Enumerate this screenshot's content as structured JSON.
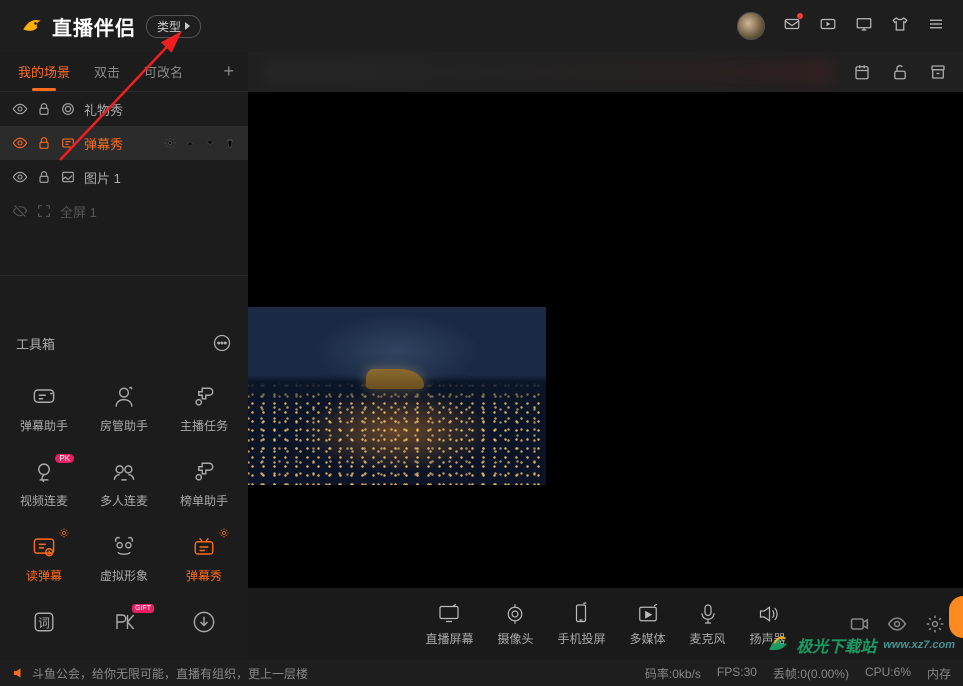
{
  "header": {
    "title": "直播伴侣",
    "type_label": "类型"
  },
  "sidebar": {
    "tabs": [
      {
        "label": "我的场景",
        "active": true
      },
      {
        "label": "双击",
        "active": false
      },
      {
        "label": "可改名",
        "active": false
      }
    ],
    "scenes": [
      {
        "name": "礼物秀",
        "active": false,
        "dim": false,
        "icon": "gift"
      },
      {
        "name": "弹幕秀",
        "active": true,
        "dim": false,
        "icon": "danmu"
      },
      {
        "name": "图片 1",
        "active": false,
        "dim": false,
        "icon": "image"
      },
      {
        "name": "全屏 1",
        "active": false,
        "dim": true,
        "icon": "fullscreen"
      }
    ],
    "toolbox_label": "工具箱",
    "tools": [
      {
        "name": "弹幕助手",
        "icon": "chat",
        "active": false
      },
      {
        "name": "房管助手",
        "icon": "admin",
        "active": false
      },
      {
        "name": "主播任务",
        "icon": "puzzle",
        "active": false
      },
      {
        "name": "视频连麦",
        "icon": "mic-video",
        "active": false,
        "badge": "PK"
      },
      {
        "name": "多人连麦",
        "icon": "multi",
        "active": false
      },
      {
        "name": "榜单助手",
        "icon": "puzzle2",
        "active": false
      },
      {
        "name": "读弹幕",
        "icon": "read",
        "active": true,
        "gear": true
      },
      {
        "name": "虚拟形象",
        "icon": "avatar",
        "active": false
      },
      {
        "name": "弹幕秀",
        "icon": "show",
        "active": true,
        "gear": true
      },
      {
        "name": "词",
        "icon": "word",
        "active": false
      },
      {
        "name": "PK",
        "icon": "pk",
        "active": false,
        "badge": "GIFT"
      },
      {
        "name": "下载",
        "icon": "download",
        "active": false
      }
    ]
  },
  "sources": [
    {
      "label": "直播屏幕",
      "icon": "screen"
    },
    {
      "label": "摄像头",
      "icon": "camera"
    },
    {
      "label": "手机投屏",
      "icon": "phone"
    },
    {
      "label": "多媒体",
      "icon": "media"
    },
    {
      "label": "麦克风",
      "icon": "microphone"
    },
    {
      "label": "扬声器",
      "icon": "speaker"
    }
  ],
  "status": {
    "announce": "斗鱼公会，给你无限可能，直播有组织，更上一层楼",
    "bitrate_label": "码率:",
    "bitrate_value": "0kb/s",
    "fps_label": "FPS:",
    "fps_value": "30",
    "drop_label": "丢帧:",
    "drop_value": "0(0.00%)",
    "cpu_label": "CPU:",
    "cpu_value": "6%",
    "mem_label": "内存"
  },
  "watermark": {
    "main": "极光下载站",
    "sub": "www.xz7.com"
  }
}
